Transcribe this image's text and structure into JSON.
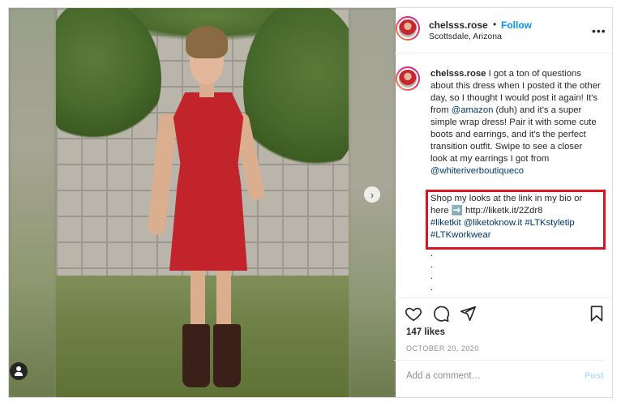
{
  "post": {
    "username": "chelsss.rose",
    "dot": "•",
    "follow_label": "Follow",
    "location": "Scottsdale, Arizona",
    "more_icon": "more-horizontal-icon"
  },
  "caption": {
    "username": "chelsss.rose",
    "text_1": " I got a ton of questions about this dress when I posted it the other day, so I thought I would post it again! It's from ",
    "mention_amazon": "@amazon",
    "text_2": " (duh) and it's a super simple wrap dress! Pair it with some cute boots and earrings, and it's the perfect transition outfit. Swipe to see a closer look at my earrings I got from ",
    "mention_boutique": "@whiteriverboutiqueco"
  },
  "shop": {
    "text_1": "Shop my looks at the link in my bio or here ",
    "arrow": "➡️",
    "link": " http://liketk.it/2Zdr8",
    "tag_liketkit": "#liketkit",
    "mention_liketoknow": "@liketoknow.it",
    "tag_styletip": "#LTKstyletip",
    "tag_workwear": "#LTKworkwear"
  },
  "dots": [
    ".",
    ".",
    ".",
    "."
  ],
  "actions": {
    "like_icon": "heart-icon",
    "comment_icon": "comment-icon",
    "share_icon": "paper-plane-icon",
    "save_icon": "bookmark-icon"
  },
  "likes_text": "147 likes",
  "date_text": "OCTOBER 20, 2020",
  "comment": {
    "placeholder": "Add a comment…",
    "post_label": "Post"
  },
  "media": {
    "next_icon": "chevron-right-icon",
    "tagged_users_icon": "user-icon"
  },
  "colors": {
    "link_blue": "#0095f6",
    "mention": "#00376b",
    "highlight_box": "#e0141e",
    "muted": "#8e8e8e"
  }
}
